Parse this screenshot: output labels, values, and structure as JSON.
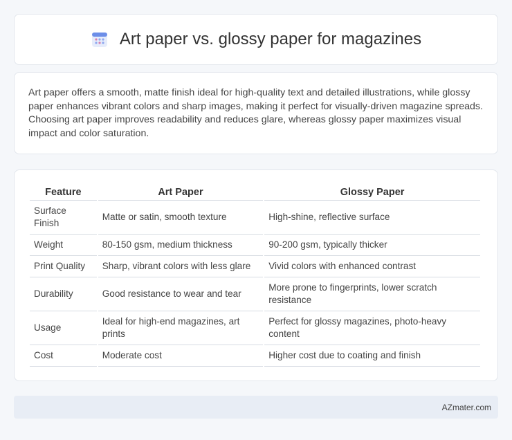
{
  "header": {
    "title": "Art paper vs. glossy paper for magazines",
    "icon": "calendar-icon"
  },
  "intro": {
    "text": "Art paper offers a smooth, matte finish ideal for high-quality text and detailed illustrations, while glossy paper enhances vibrant colors and sharp images, making it perfect for visually-driven magazine spreads. Choosing art paper improves readability and reduces glare, whereas glossy paper maximizes visual impact and color saturation."
  },
  "table": {
    "headers": [
      "Feature",
      "Art Paper",
      "Glossy Paper"
    ],
    "rows": [
      [
        "Surface Finish",
        "Matte or satin, smooth texture",
        "High-shine, reflective surface"
      ],
      [
        "Weight",
        "80-150 gsm, medium thickness",
        "90-200 gsm, typically thicker"
      ],
      [
        "Print Quality",
        "Sharp, vibrant colors with less glare",
        "Vivid colors with enhanced contrast"
      ],
      [
        "Durability",
        "Good resistance to wear and tear",
        "More prone to fingerprints, lower scratch resistance"
      ],
      [
        "Usage",
        "Ideal for high-end magazines, art prints",
        "Perfect for glossy magazines, photo-heavy content"
      ],
      [
        "Cost",
        "Moderate cost",
        "Higher cost due to coating and finish"
      ]
    ]
  },
  "footer": {
    "brand": "AZmater.com"
  },
  "colors": {
    "background": "#f5f7fa",
    "card": "#ffffff",
    "footer_bg": "#e8edf5",
    "icon_accent": "#6c8ee8"
  }
}
